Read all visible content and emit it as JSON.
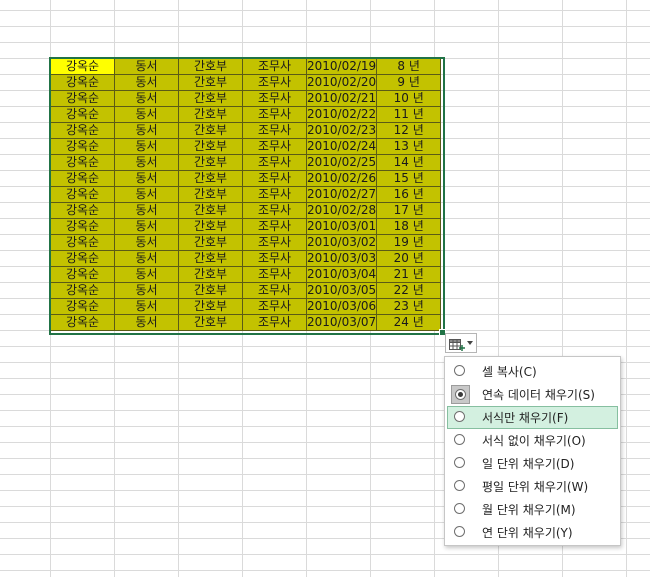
{
  "spreadsheet": {
    "rows": [
      [
        "강옥순",
        "동서",
        "간호부",
        "조무사",
        "2010/02/19",
        "8 년"
      ],
      [
        "강옥순",
        "동서",
        "간호부",
        "조무사",
        "2010/02/20",
        "9 년"
      ],
      [
        "강옥순",
        "동서",
        "간호부",
        "조무사",
        "2010/02/21",
        "10 년"
      ],
      [
        "강옥순",
        "동서",
        "간호부",
        "조무사",
        "2010/02/22",
        "11 년"
      ],
      [
        "강옥순",
        "동서",
        "간호부",
        "조무사",
        "2010/02/23",
        "12 년"
      ],
      [
        "강옥순",
        "동서",
        "간호부",
        "조무사",
        "2010/02/24",
        "13 년"
      ],
      [
        "강옥순",
        "동서",
        "간호부",
        "조무사",
        "2010/02/25",
        "14 년"
      ],
      [
        "강옥순",
        "동서",
        "간호부",
        "조무사",
        "2010/02/26",
        "15 년"
      ],
      [
        "강옥순",
        "동서",
        "간호부",
        "조무사",
        "2010/02/27",
        "16 년"
      ],
      [
        "강옥순",
        "동서",
        "간호부",
        "조무사",
        "2010/02/28",
        "17 년"
      ],
      [
        "강옥순",
        "동서",
        "간호부",
        "조무사",
        "2010/03/01",
        "18 년"
      ],
      [
        "강옥순",
        "동서",
        "간호부",
        "조무사",
        "2010/03/02",
        "19 년"
      ],
      [
        "강옥순",
        "동서",
        "간호부",
        "조무사",
        "2010/03/03",
        "20 년"
      ],
      [
        "강옥순",
        "동서",
        "간호부",
        "조무사",
        "2010/03/04",
        "21 년"
      ],
      [
        "강옥순",
        "동서",
        "간호부",
        "조무사",
        "2010/03/05",
        "22 년"
      ],
      [
        "강옥순",
        "동서",
        "간호부",
        "조무사",
        "2010/03/06",
        "23 년"
      ],
      [
        "강옥순",
        "동서",
        "간호부",
        "조무사",
        "2010/03/07",
        "24 년"
      ]
    ],
    "colors": {
      "fill": "#c3c200",
      "active_cell_fill": "#ffff00",
      "selection_border": "#217346"
    }
  },
  "autofill": {
    "button_icon": "auto-fill-options-icon",
    "dropdown_icon": "chevron-down-icon",
    "menu": [
      {
        "label": "셀 복사(C)",
        "checked": false,
        "highlight": false
      },
      {
        "label": "연속 데이터 채우기(S)",
        "checked": true,
        "highlight": false
      },
      {
        "label": "서식만 채우기(F)",
        "checked": false,
        "highlight": true
      },
      {
        "label": "서식 없이 채우기(O)",
        "checked": false,
        "highlight": false
      },
      {
        "label": "일 단위 채우기(D)",
        "checked": false,
        "highlight": false
      },
      {
        "label": "평일 단위 채우기(W)",
        "checked": false,
        "highlight": false
      },
      {
        "label": "월 단위 채우기(M)",
        "checked": false,
        "highlight": false
      },
      {
        "label": "연 단위 채우기(Y)",
        "checked": false,
        "highlight": false
      }
    ]
  }
}
